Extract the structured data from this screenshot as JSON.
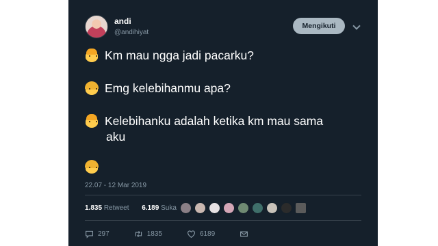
{
  "tweet": {
    "author_name": "andi",
    "author_handle": "@andihiyat",
    "follow_button": "Mengikuti",
    "lines": [
      "Km mau ngga jadi pacarku?",
      "Emg kelebihanmu apa?",
      "Kelebihanku adalah ketika km mau sama",
      "aku"
    ],
    "timestamp": "22.07 - 12 Mar 2019",
    "retweet_count": "1.835",
    "retweet_label": "Retweet",
    "like_count": "6.189",
    "like_label": "Suka",
    "reply_action_count": "297",
    "retweet_action_count": "1835",
    "like_action_count": "6189"
  },
  "icons": {
    "reply": "comment-icon",
    "retweet": "retweet-icon",
    "like": "heart-icon",
    "dm": "mail-icon"
  },
  "colors": {
    "background": "#15202b",
    "text": "#ffffff",
    "secondary": "#8899a6",
    "follow_button": "#aab8c2"
  }
}
